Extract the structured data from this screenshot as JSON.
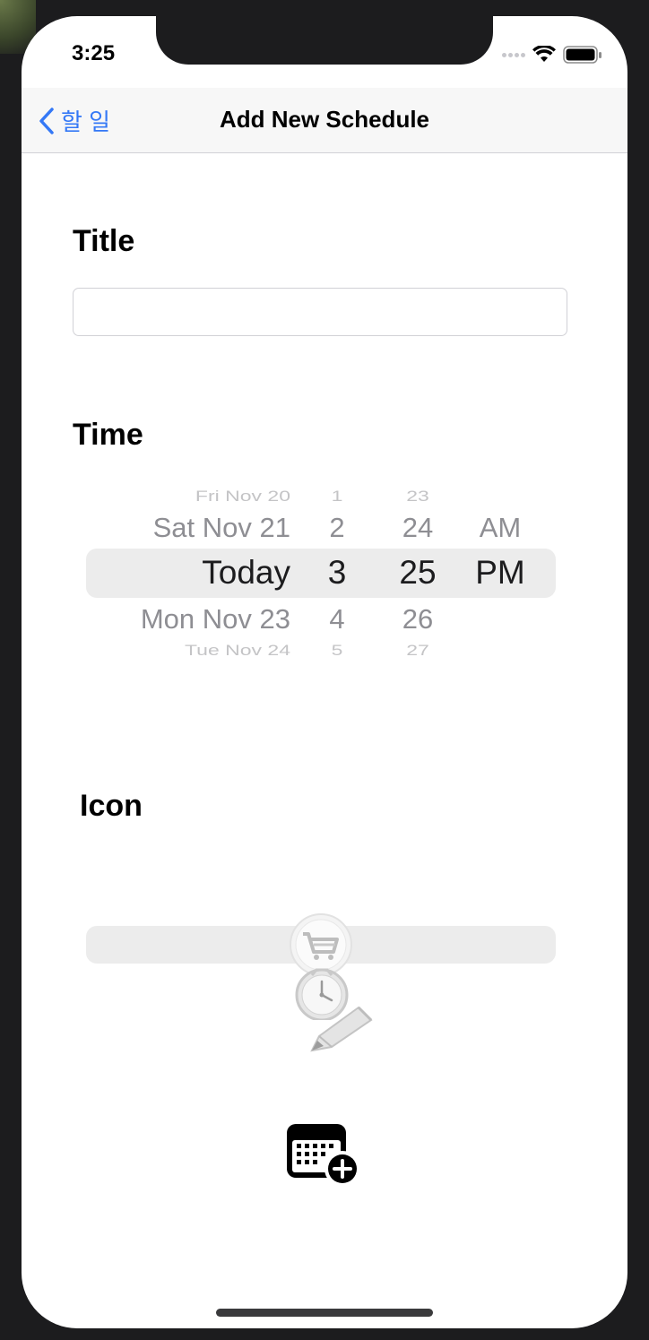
{
  "status_bar": {
    "time": "3:25"
  },
  "nav": {
    "back_label": "할 일",
    "title": "Add New Schedule"
  },
  "form": {
    "title_label": "Title",
    "title_value": "",
    "time_label": "Time",
    "icon_label": "Icon"
  },
  "time_picker": {
    "rows": [
      {
        "date": "Fri Nov 20",
        "hour": "1",
        "minute": "23",
        "ampm": ""
      },
      {
        "date": "Sat Nov 21",
        "hour": "2",
        "minute": "24",
        "ampm": "AM"
      },
      {
        "date": "Today",
        "hour": "3",
        "minute": "25",
        "ampm": "PM"
      },
      {
        "date": "Mon Nov 23",
        "hour": "4",
        "minute": "26",
        "ampm": ""
      },
      {
        "date": "Tue Nov 24",
        "hour": "5",
        "minute": "27",
        "ampm": ""
      }
    ]
  },
  "icon_picker": {
    "items": [
      "cart-icon",
      "clock-icon",
      "pencil-icon"
    ]
  },
  "actions": {
    "add_button_icon": "calendar-plus-icon"
  },
  "colors": {
    "accent": "#3478f6",
    "picker_highlight": "#ececec"
  }
}
